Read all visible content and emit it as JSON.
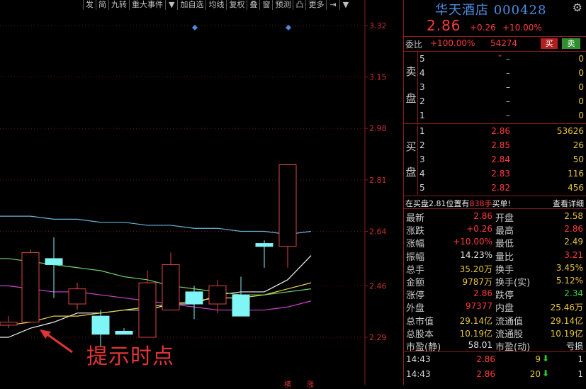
{
  "toolbar": [
    "发",
    "简",
    "九转",
    "重大事件",
    "▼",
    "加自选",
    "均线",
    "复权",
    "叠",
    "窗",
    "预测",
    "凸",
    "更多",
    "⇥",
    "▼"
  ],
  "annotation": "提示时点",
  "bottom_labels": [
    "横",
    "涨"
  ],
  "chart_data": {
    "type": "candlestick",
    "y_ticks": [
      "3.32",
      "3.15",
      "2.98",
      "2.81",
      "2.64",
      "2.46",
      "2.29"
    ],
    "ylim": [
      2.22,
      3.32
    ],
    "candles": [
      {
        "o": 2.33,
        "h": 2.36,
        "l": 2.32,
        "c": 2.34
      },
      {
        "o": 2.34,
        "h": 2.58,
        "l": 2.34,
        "c": 2.57
      },
      {
        "o": 2.55,
        "h": 2.62,
        "l": 2.42,
        "c": 2.53
      },
      {
        "o": 2.4,
        "h": 2.47,
        "l": 2.38,
        "c": 2.45
      },
      {
        "o": 2.36,
        "h": 2.38,
        "l": 2.26,
        "c": 2.3
      },
      {
        "o": 2.31,
        "h": 2.32,
        "l": 2.3,
        "c": 2.3
      },
      {
        "o": 2.29,
        "h": 2.51,
        "l": 2.29,
        "c": 2.47
      },
      {
        "o": 2.38,
        "h": 2.57,
        "l": 2.38,
        "c": 2.53
      },
      {
        "o": 2.44,
        "h": 2.46,
        "l": 2.35,
        "c": 2.4
      },
      {
        "o": 2.4,
        "h": 2.48,
        "l": 2.37,
        "c": 2.46
      },
      {
        "o": 2.43,
        "h": 2.49,
        "l": 2.36,
        "c": 2.36
      },
      {
        "o": 2.6,
        "h": 2.61,
        "l": 2.52,
        "c": 2.59
      },
      {
        "o": 2.59,
        "h": 2.86,
        "l": 2.52,
        "c": 2.86
      }
    ],
    "candle_x": [
      12,
      43,
      76,
      109,
      142,
      175,
      208,
      241,
      274,
      307,
      340,
      373,
      406,
      439
    ],
    "ma_series": [
      {
        "name": "MA-white",
        "color": "#f2f2f2",
        "values": [
          2.29,
          2.32,
          2.34,
          2.37,
          2.37,
          2.38,
          2.38,
          2.4,
          2.4,
          2.43,
          2.44,
          2.44,
          2.48,
          2.56
        ]
      },
      {
        "name": "MA-yellow",
        "color": "#e8d44a",
        "values": [
          2.33,
          2.34,
          2.36,
          2.36,
          2.37,
          2.38,
          2.39,
          2.4,
          2.41,
          2.42,
          2.42,
          2.43,
          2.45,
          2.47
        ]
      },
      {
        "name": "MA-green",
        "color": "#74d46c",
        "values": [
          2.55,
          2.54,
          2.53,
          2.52,
          2.51,
          2.49,
          2.48,
          2.46,
          2.45,
          2.44,
          2.43,
          2.43,
          2.44,
          2.45
        ]
      },
      {
        "name": "MA-purple",
        "color": "#cc44cc",
        "values": [
          2.46,
          2.45,
          2.44,
          2.44,
          2.43,
          2.42,
          2.41,
          2.4,
          2.39,
          2.38,
          2.38,
          2.38,
          2.39,
          2.41
        ]
      },
      {
        "name": "MA-cyan",
        "color": "#6ab4d6",
        "values": [
          2.69,
          2.69,
          2.68,
          2.68,
          2.67,
          2.67,
          2.66,
          2.66,
          2.65,
          2.65,
          2.64,
          2.64,
          2.63,
          2.64
        ]
      }
    ],
    "markers": [
      {
        "x": 275,
        "y": 3.32
      },
      {
        "x": 407,
        "y": 3.32
      }
    ]
  },
  "quote": {
    "name": "华天酒店 000428",
    "price": "2.86",
    "change": "+0.26",
    "pct": "+10.00%",
    "wb_label": "委比",
    "wb_value": "+100.00%",
    "wb_diff": "54274",
    "buy_btn": "买",
    "sell_btn": "卖",
    "sell_label": [
      "卖",
      "盘"
    ],
    "buy_label": [
      "买",
      "盘"
    ],
    "sell_orders": [
      {
        "i": "5",
        "p": "–",
        "v": "0"
      },
      {
        "i": "4",
        "p": "–",
        "v": "0"
      },
      {
        "i": "3",
        "p": "–",
        "v": "0"
      },
      {
        "i": "2",
        "p": "–",
        "v": "0"
      },
      {
        "i": "1",
        "p": "–",
        "v": "0"
      }
    ],
    "buy_orders": [
      {
        "i": "1",
        "p": "2.86",
        "v": "53626"
      },
      {
        "i": "2",
        "p": "2.85",
        "v": "26"
      },
      {
        "i": "3",
        "p": "2.84",
        "v": "50"
      },
      {
        "i": "4",
        "p": "2.83",
        "v": "116"
      },
      {
        "i": "5",
        "p": "2.82",
        "v": "456"
      }
    ],
    "info_text": "在买盘",
    "info_price": "2.81",
    "info_mid": "位置有",
    "info_qty": "838手",
    "info_tail": "买单!",
    "info_link": "查看详细",
    "stats": [
      {
        "l": "最新",
        "lv": "2.86",
        "lc": "red",
        "r": "开盘",
        "rv": "2.58",
        "rc": "yel"
      },
      {
        "l": "涨跌",
        "lv": "+0.26",
        "lc": "red",
        "r": "最高",
        "rv": "2.86",
        "rc": "red"
      },
      {
        "l": "涨幅",
        "lv": "+10.00%",
        "lc": "red",
        "r": "最低",
        "rv": "2.49",
        "rc": "yel"
      },
      {
        "l": "振幅",
        "lv": "14.23%",
        "lc": "wht",
        "r": "量比",
        "rv": "3.21",
        "rc": "red"
      },
      {
        "l": "总手",
        "lv": "35.20万",
        "lc": "yel",
        "r": "换手",
        "rv": "3.45%",
        "rc": "yel"
      },
      {
        "l": "金额",
        "lv": "9787万",
        "lc": "yel",
        "r": "换手(实)",
        "rv": "5.12%",
        "rc": "yel"
      },
      {
        "l": "涨停",
        "lv": "2.86",
        "lc": "red",
        "r": "跌停",
        "rv": "2.34",
        "rc": "grn"
      },
      {
        "l": "外盘",
        "lv": "97377",
        "lc": "red",
        "r": "内盘",
        "rv": "25.46万",
        "rc": "yel"
      },
      {
        "l": "总市值",
        "lv": "29.14亿",
        "lc": "yel",
        "r": "流通值",
        "rv": "29.14亿",
        "rc": "yel"
      },
      {
        "l": "总股本",
        "lv": "10.19亿",
        "lc": "yel",
        "r": "流通股",
        "rv": "10.19亿",
        "rc": "yel"
      },
      {
        "l": "市盈(静)",
        "lv": "58.01",
        "lc": "wht",
        "r": "市盈(动)",
        "rv": "亏损",
        "rc": "wht"
      }
    ],
    "ticks": [
      {
        "t": "14:43",
        "p": "2.86",
        "v": "9",
        "n": "1"
      },
      {
        "t": "14:43",
        "p": "2.86",
        "v": "20",
        "n": "1"
      }
    ]
  }
}
